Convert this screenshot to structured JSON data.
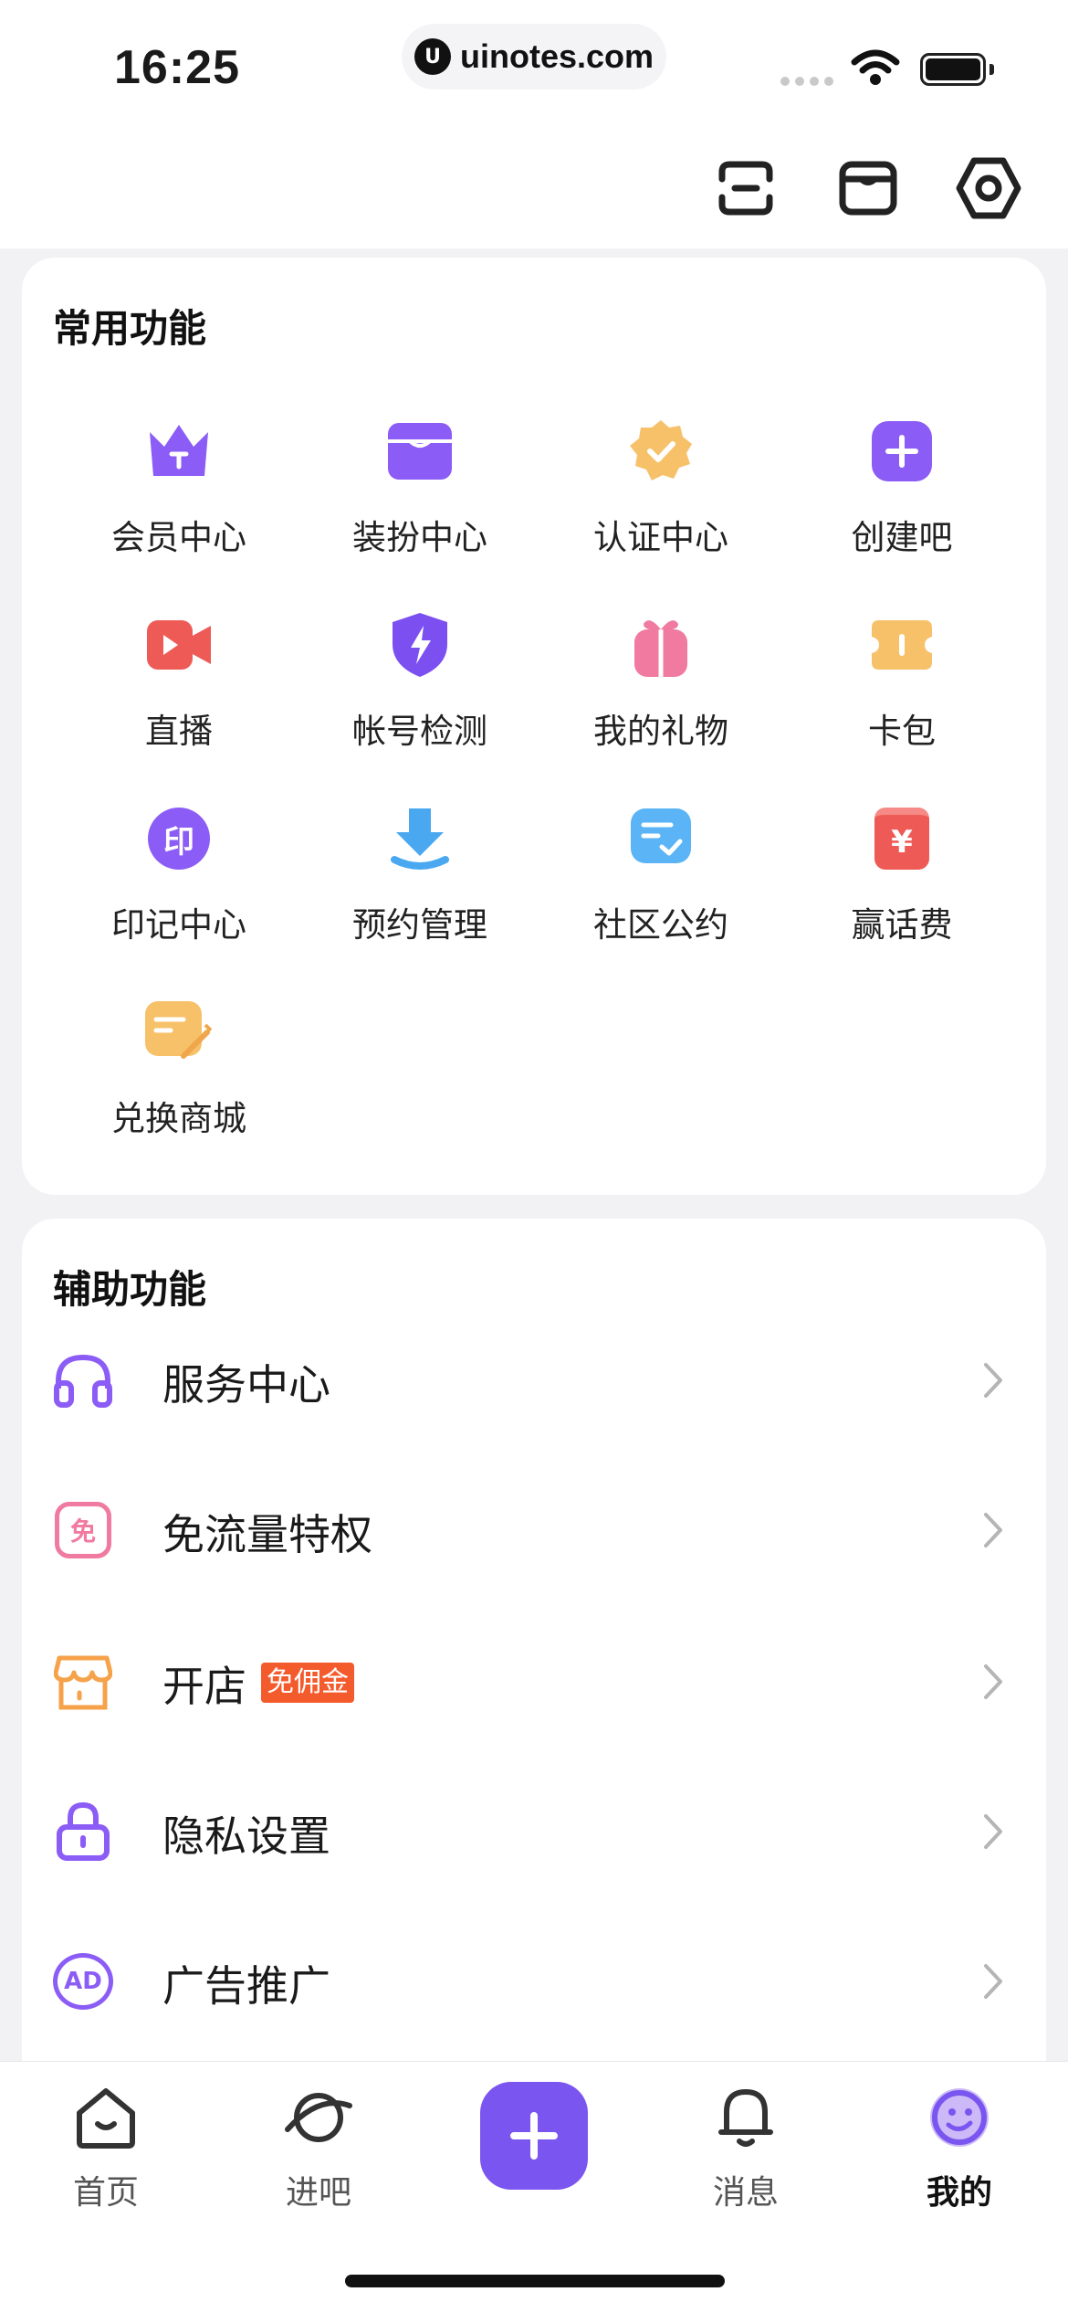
{
  "status_bar": {
    "time": "16:25",
    "url": "uinotes.com",
    "url_logo": "U"
  },
  "top_actions": [
    {
      "icon": "scan-icon"
    },
    {
      "icon": "store-icon"
    },
    {
      "icon": "settings-icon"
    }
  ],
  "common_functions": {
    "title": "常用功能",
    "items": [
      {
        "label": "会员中心",
        "icon": "crown-icon",
        "color": "#8b5cf6"
      },
      {
        "label": "装扮中心",
        "icon": "wardrobe-icon",
        "color": "#8b5cf6"
      },
      {
        "label": "认证中心",
        "icon": "verified-badge-icon",
        "color": "#f7c16a"
      },
      {
        "label": "创建吧",
        "icon": "plus-square-icon",
        "color": "#8b5cf6"
      },
      {
        "label": "直播",
        "icon": "video-camera-icon",
        "color": "#ee5b57"
      },
      {
        "label": "帐号检测",
        "icon": "shield-bolt-icon",
        "color": "#7c4ff0"
      },
      {
        "label": "我的礼物",
        "icon": "gift-icon",
        "color": "#f07aa0"
      },
      {
        "label": "卡包",
        "icon": "ticket-icon",
        "color": "#f7c16a"
      },
      {
        "label": "印记中心",
        "icon": "seal-icon",
        "color": "#8b5cf6",
        "icon_text": "印"
      },
      {
        "label": "预约管理",
        "icon": "download-tray-icon",
        "color": "#4aa8f0"
      },
      {
        "label": "社区公约",
        "icon": "checklist-chat-icon",
        "color": "#5ab4f5"
      },
      {
        "label": "赢话费",
        "icon": "red-envelope-yen-icon",
        "color": "#ee5b57",
        "icon_text": "¥"
      },
      {
        "label": "兑换商城",
        "icon": "note-pencil-icon",
        "color": "#f7c16a"
      }
    ]
  },
  "aux_functions": {
    "title": "辅助功能",
    "items": [
      {
        "label": "服务中心",
        "icon": "headphones-icon",
        "color": "#8b5cf6"
      },
      {
        "label": "免流量特权",
        "icon": "free-data-icon",
        "color": "#f07aa0",
        "icon_text": "免"
      },
      {
        "label": "开店",
        "icon": "shop-icon",
        "color": "#f5a24a",
        "badge": "免佣金"
      },
      {
        "label": "隐私设置",
        "icon": "lock-icon",
        "color": "#8b5cf6"
      },
      {
        "label": "广告推广",
        "icon": "ad-icon",
        "color": "#8b5cf6",
        "icon_text": "AD"
      }
    ]
  },
  "tabbar": {
    "tabs": [
      {
        "label": "首页",
        "icon": "home-icon"
      },
      {
        "label": "进吧",
        "icon": "planet-icon"
      },
      {
        "label": "消息",
        "icon": "bell-icon"
      },
      {
        "label": "我的",
        "icon": "profile-face-icon",
        "active": true
      }
    ],
    "plus_icon": "plus-icon",
    "accent": "#7a55f0"
  }
}
